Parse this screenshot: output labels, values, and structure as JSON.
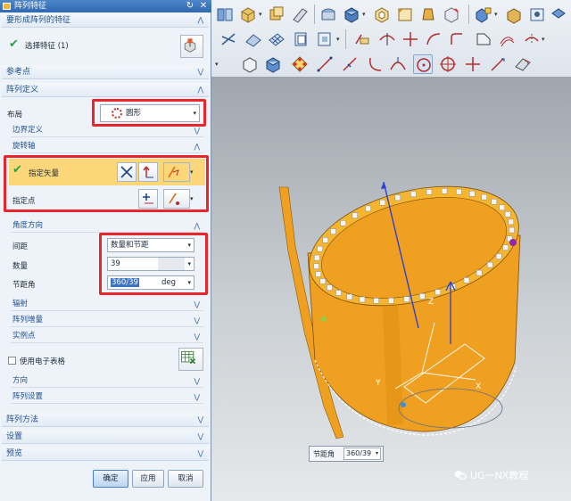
{
  "dialog": {
    "title": "阵列特征",
    "features_section": "要形成阵列的特征",
    "select_feature_label": "选择特征 (1)",
    "reference_point": "参考点",
    "array_definition": "阵列定义",
    "layout_label": "布局",
    "layout_value": "圆形",
    "boundary_definition": "边界定义",
    "rotation_axis": "旋转轴",
    "specify_vector": "指定矢量",
    "specify_point": "指定点",
    "angle_direction": "角度方向",
    "spacing_label": "间距",
    "spacing_value": "数量和节距",
    "count_label": "数量",
    "count_value": "39",
    "pitch_angle_label": "节距角",
    "pitch_angle_value": "360/39",
    "pitch_angle_unit": "deg",
    "radiate": "辐射",
    "array_increment": "阵列增量",
    "instance_point": "实例点",
    "use_spreadsheet": "使用电子表格",
    "orientation": "方向",
    "array_settings": "阵列设置",
    "array_method": "阵列方法",
    "settings": "设置",
    "preview": "预览",
    "ok_button": "确定",
    "apply_button": "应用",
    "cancel_button": "取消"
  },
  "viewport": {
    "axis_label_z": "Z",
    "axis_label_y": "Y",
    "axis_label_x": "X",
    "pitch_tooltip_label": "节距角",
    "pitch_tooltip_value": "360/39"
  },
  "watermark": "UG一NX教程",
  "colors": {
    "accent_red": "#e8262c",
    "model_orange": "#f0a020",
    "title_blue": "#2f69b0"
  }
}
